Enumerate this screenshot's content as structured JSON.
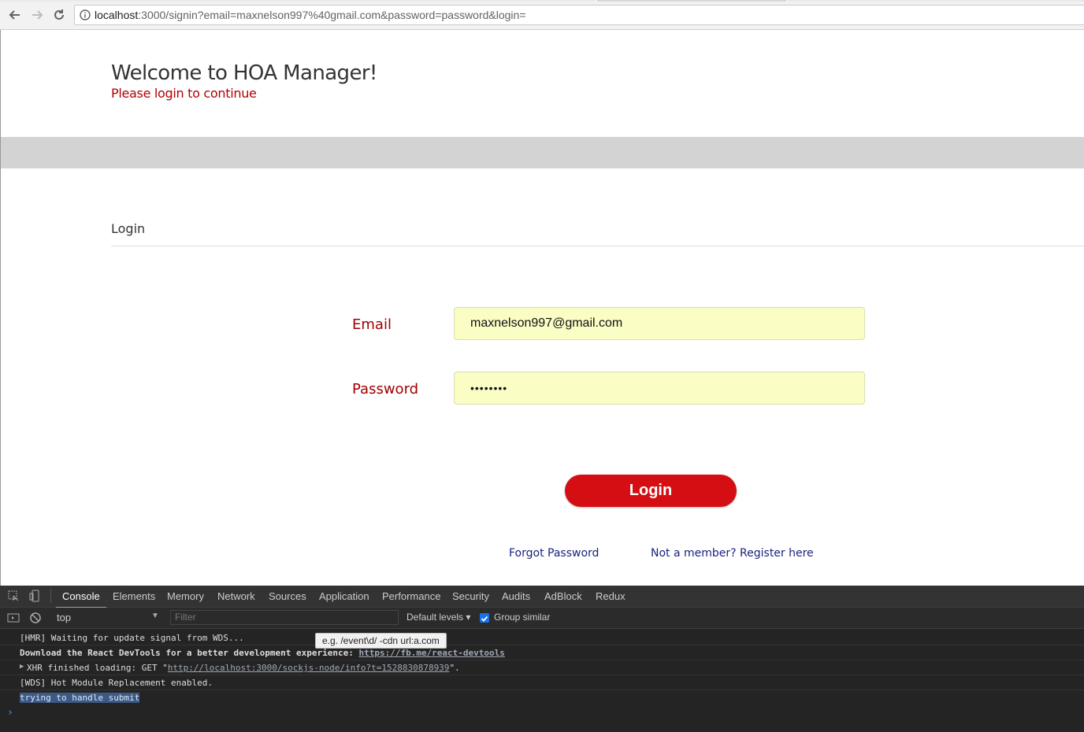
{
  "browser": {
    "url_host": "localhost",
    "url_rest": ":3000/signin?email=maxnelson997%40gmail.com&password=password&login=",
    "back_icon": "arrow-left-icon",
    "forward_icon": "arrow-right-icon",
    "reload_icon": "reload-icon",
    "info_icon": "info-icon"
  },
  "page": {
    "title": "Welcome to HOA Manager!",
    "subtitle": "Please login to continue",
    "section_heading": "Login",
    "email_label": "Email",
    "email_value": "maxnelson997@gmail.com",
    "password_label": "Password",
    "password_value": "••••••••",
    "login_button": "Login",
    "forgot_link": "Forgot Password",
    "register_link": "Not a member? Register here",
    "accent_color": "#d40e13",
    "label_color": "#a00000",
    "field_bg": "#fafdc4"
  },
  "devtools": {
    "tabs": [
      "Console",
      "Elements",
      "Memory",
      "Network",
      "Sources",
      "Application",
      "Performance",
      "Security",
      "Audits",
      "AdBlock",
      "Redux"
    ],
    "active_tab": "Console",
    "context": "top",
    "filter_placeholder": "Filter",
    "levels": "Default levels",
    "group_similar": "Group similar",
    "tooltip": "e.g. /event\\d/ -cdn url:a.com",
    "console": {
      "line1": "[HMR] Waiting for update signal from WDS...",
      "line2_text": "Download the React DevTools for a better development experience: ",
      "line2_link": "https://fb.me/react-devtools",
      "line3_prefix": "XHR finished loading: GET \"",
      "line3_link": "http://localhost:3000/sockjs-node/info?t=1528830878939",
      "line3_suffix": "\".",
      "line4": "[WDS] Hot Module Replacement enabled.",
      "line5": "trying to handle submit"
    }
  }
}
